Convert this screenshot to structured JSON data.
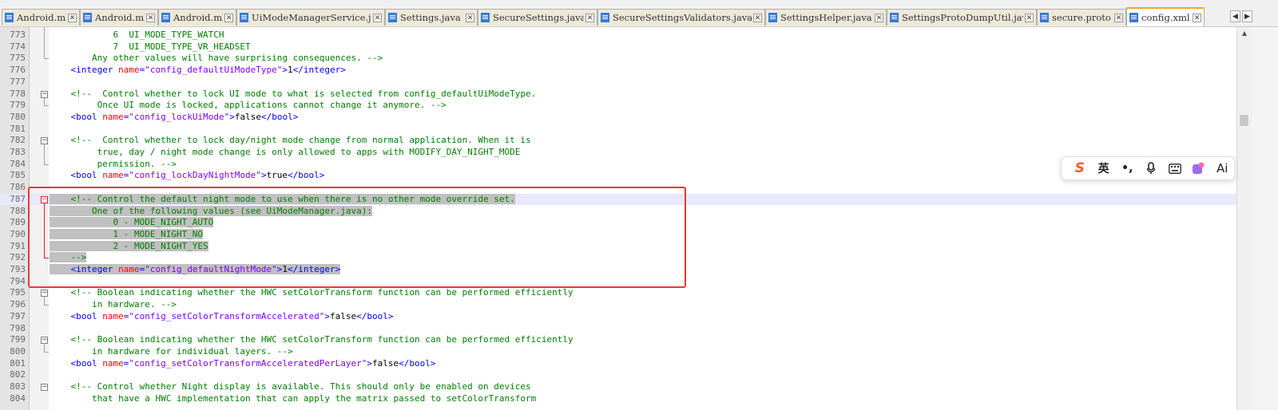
{
  "tabs": [
    {
      "label": "Android.mk",
      "active": false
    },
    {
      "label": "Android.mk",
      "active": false
    },
    {
      "label": "Android.mk",
      "active": false
    },
    {
      "label": "UiModeManagerService.java",
      "active": false
    },
    {
      "label": "Settings.java",
      "active": false
    },
    {
      "label": "SecureSettings.java",
      "active": false
    },
    {
      "label": "SecureSettingsValidators.java",
      "active": false
    },
    {
      "label": "SettingsHelper.java",
      "active": false
    },
    {
      "label": "SettingsProtoDumpUtil.java",
      "active": false
    },
    {
      "label": "secure.proto",
      "active": false
    },
    {
      "label": "config.xml",
      "active": true
    }
  ],
  "tab_close_glyph": "✕",
  "tab_nav": {
    "left": "◀",
    "right": "▶"
  },
  "ime": {
    "logo": "S",
    "lang": "英",
    "punct": "•,",
    "mic_icon": "microphone-icon",
    "keyboard_icon": "keyboard-icon",
    "skin_icon": "skin-icon",
    "ai": "Ai"
  },
  "scroll_arrows": {
    "up": "▲",
    "down": "▼"
  },
  "lines": [
    {
      "n": "773",
      "segs": [
        [
          "c",
          "            6  UI_MODE_TYPE_WATCH"
        ]
      ]
    },
    {
      "n": "774",
      "segs": [
        [
          "c",
          "            7  UI_MODE_TYPE_VR_HEADSET"
        ]
      ]
    },
    {
      "n": "775",
      "segs": [
        [
          "c",
          "        Any other values will have surprising consequences. -->"
        ]
      ]
    },
    {
      "n": "776",
      "segs": [
        [
          "t",
          "    <integer "
        ],
        [
          "a",
          "name"
        ],
        [
          "t",
          "="
        ],
        [
          "v",
          "\"config_defaultUiModeType\""
        ],
        [
          "t",
          ">"
        ],
        [
          "x",
          "1"
        ],
        [
          "t",
          "</integer>"
        ]
      ]
    },
    {
      "n": "777",
      "segs": []
    },
    {
      "n": "778",
      "segs": [
        [
          "c",
          "    <!--  Control whether to lock UI mode to what is selected from config_defaultUiModeType."
        ]
      ]
    },
    {
      "n": "779",
      "segs": [
        [
          "c",
          "         Once UI mode is locked, applications cannot change it anymore. -->"
        ]
      ]
    },
    {
      "n": "780",
      "segs": [
        [
          "t",
          "    <bool "
        ],
        [
          "a",
          "name"
        ],
        [
          "t",
          "="
        ],
        [
          "v",
          "\"config_lockUiMode\""
        ],
        [
          "t",
          ">"
        ],
        [
          "x",
          "false"
        ],
        [
          "t",
          "</bool>"
        ]
      ]
    },
    {
      "n": "781",
      "segs": []
    },
    {
      "n": "782",
      "segs": [
        [
          "c",
          "    <!--  Control whether to lock day/night mode change from normal application. When it is"
        ]
      ]
    },
    {
      "n": "783",
      "segs": [
        [
          "c",
          "         true, day / night mode change is only allowed to apps with MODIFY_DAY_NIGHT_MODE"
        ]
      ]
    },
    {
      "n": "784",
      "segs": [
        [
          "c",
          "         permission. -->"
        ]
      ]
    },
    {
      "n": "785",
      "segs": [
        [
          "t",
          "    <bool "
        ],
        [
          "a",
          "name"
        ],
        [
          "t",
          "="
        ],
        [
          "v",
          "\"config_lockDayNightMode\""
        ],
        [
          "t",
          ">"
        ],
        [
          "x",
          "true"
        ],
        [
          "t",
          "</bool>"
        ]
      ]
    },
    {
      "n": "786",
      "segs": []
    },
    {
      "n": "787",
      "segs": [
        [
          "c",
          "    <!-- Control the default night mode to use when there is no other mode override set."
        ]
      ],
      "sel": true,
      "current": true
    },
    {
      "n": "788",
      "segs": [
        [
          "c",
          "        One of the following values (see UiModeManager.java):"
        ]
      ],
      "sel": true
    },
    {
      "n": "789",
      "segs": [
        [
          "c",
          "            0 - MODE_NIGHT_AUTO"
        ]
      ],
      "sel": true
    },
    {
      "n": "790",
      "segs": [
        [
          "c",
          "            1 - MODE_NIGHT_NO"
        ]
      ],
      "sel": true
    },
    {
      "n": "791",
      "segs": [
        [
          "c",
          "            2 - MODE_NIGHT_YES"
        ]
      ],
      "sel": true
    },
    {
      "n": "792",
      "segs": [
        [
          "c",
          "    -->"
        ]
      ],
      "sel": true
    },
    {
      "n": "793",
      "segs": [
        [
          "t",
          "    <integer "
        ],
        [
          "a",
          "name"
        ],
        [
          "t",
          "="
        ],
        [
          "v",
          "\"config_defaultNightMode\""
        ],
        [
          "t",
          ">"
        ],
        [
          "x",
          "1"
        ],
        [
          "t",
          "</integer>"
        ]
      ],
      "sel": true
    },
    {
      "n": "794",
      "segs": []
    },
    {
      "n": "795",
      "segs": [
        [
          "c",
          "    <!-- Boolean indicating whether the HWC setColorTransform function can be performed efficiently"
        ]
      ]
    },
    {
      "n": "796",
      "segs": [
        [
          "c",
          "        in hardware. -->"
        ]
      ]
    },
    {
      "n": "797",
      "segs": [
        [
          "t",
          "    <bool "
        ],
        [
          "a",
          "name"
        ],
        [
          "t",
          "="
        ],
        [
          "v",
          "\"config_setColorTransformAccelerated\""
        ],
        [
          "t",
          ">"
        ],
        [
          "x",
          "false"
        ],
        [
          "t",
          "</bool>"
        ]
      ]
    },
    {
      "n": "798",
      "segs": []
    },
    {
      "n": "799",
      "segs": [
        [
          "c",
          "    <!-- Boolean indicating whether the HWC setColorTransform function can be performed efficiently"
        ]
      ]
    },
    {
      "n": "800",
      "segs": [
        [
          "c",
          "        in hardware for individual layers. -->"
        ]
      ]
    },
    {
      "n": "801",
      "segs": [
        [
          "t",
          "    <bool "
        ],
        [
          "a",
          "name"
        ],
        [
          "t",
          "="
        ],
        [
          "v",
          "\"config_setColorTransformAcceleratedPerLayer\""
        ],
        [
          "t",
          ">"
        ],
        [
          "x",
          "false"
        ],
        [
          "t",
          "</bool>"
        ]
      ]
    },
    {
      "n": "802",
      "segs": []
    },
    {
      "n": "803",
      "segs": [
        [
          "c",
          "    <!-- Control whether Night display is available. This should only be enabled on devices"
        ]
      ]
    },
    {
      "n": "804",
      "segs": [
        [
          "c",
          "        that have a HWC implementation that can apply the matrix passed to setColorTransform"
        ]
      ]
    }
  ]
}
